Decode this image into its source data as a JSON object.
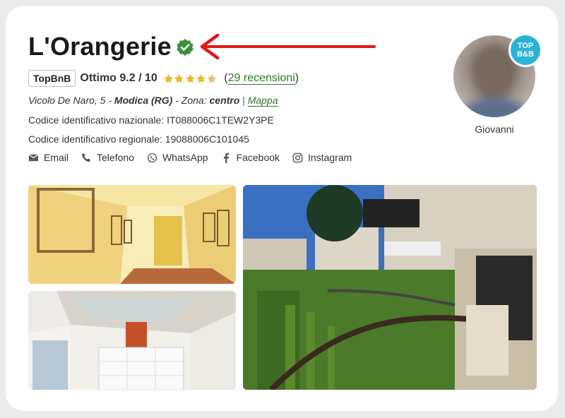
{
  "listing": {
    "title": "L'Orangerie",
    "badge": "TopBnB",
    "score": "Ottimo 9.2 / 10",
    "stars_value": 4.5,
    "reviews_prefix": "(",
    "reviews_link": "29 recensioni",
    "reviews_suffix": ")",
    "address_street": "Vicolo De Naro, 5 - ",
    "address_city": "Modica (RG)",
    "address_zone_label": " - Zona: ",
    "address_zone": "centro",
    "address_sep": " | ",
    "map_link": "Mappa",
    "national_code": "Codice identificativo nazionale: IT088006C1TEW2Y3PE",
    "regional_code": "Codice identificativo regionale: 19088006C101045"
  },
  "contacts": [
    {
      "label": "Email",
      "icon": "email-icon"
    },
    {
      "label": "Telefono",
      "icon": "phone-icon"
    },
    {
      "label": "WhatsApp",
      "icon": "whatsapp-icon"
    },
    {
      "label": "Facebook",
      "icon": "facebook-icon"
    },
    {
      "label": "Instagram",
      "icon": "instagram-icon"
    }
  ],
  "host": {
    "name": "Giovanni",
    "badge_line1": "TOP",
    "badge_line2": "B&B"
  },
  "colors": {
    "accent_green": "#2a7a2a",
    "verified_green": "#3a8f3a",
    "arrow_red": "#e0181b",
    "star_gold": "#f0b429",
    "top_badge_blue": "#2ab3d6"
  }
}
